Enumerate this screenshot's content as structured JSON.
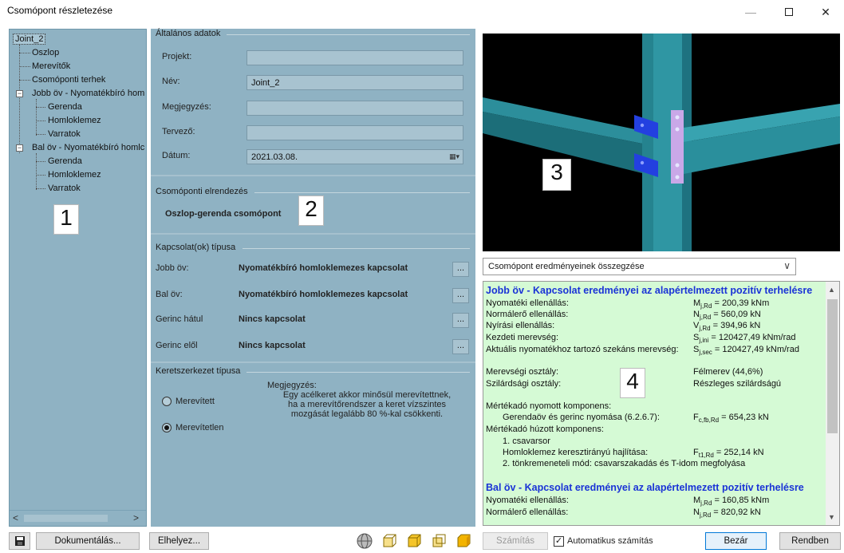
{
  "window": {
    "title": "Csomópont részletezése",
    "minimize": "—",
    "close": "✕"
  },
  "tree": {
    "root": "Joint_2",
    "items": [
      "Oszlop",
      "Merevítők",
      "Csomóponti terhek"
    ],
    "right_chord": {
      "label": "Jobb öv - Nyomatékbíró hom",
      "children": [
        "Gerenda",
        "Homloklemez",
        "Varratok"
      ]
    },
    "left_chord": {
      "label": "Bal öv - Nyomatékbíró homlc",
      "children": [
        "Gerenda",
        "Homloklemez",
        "Varratok"
      ]
    },
    "expander_symbol": "⊟",
    "scroll_left": "<",
    "scroll_right": ">"
  },
  "general": {
    "title": "Általános adatok",
    "project_label": "Projekt:",
    "project_value": "",
    "name_label": "Név:",
    "name_value": "Joint_2",
    "comment_label": "Megjegyzés:",
    "comment_value": "",
    "designer_label": "Tervező:",
    "designer_value": "",
    "date_label": "Dátum:",
    "date_value": "2021.03.08.",
    "date_icon": "▦▾"
  },
  "layout": {
    "title": "Csomóponti elrendezés",
    "value": "Oszlop-gerenda csomópont"
  },
  "connections": {
    "title": "Kapcsolat(ok) típusa",
    "dots": "...",
    "rows": [
      {
        "label": "Jobb öv:",
        "value": "Nyomatékbíró homloklemezes kapcsolat"
      },
      {
        "label": "Bal öv:",
        "value": "Nyomatékbíró homloklemezes kapcsolat"
      },
      {
        "label": "Gerinc hátul",
        "value": "Nincs kapcsolat"
      },
      {
        "label": "Gerinc elől",
        "value": "Nincs kapcsolat"
      }
    ]
  },
  "frame": {
    "title": "Keretszerkezet típusa",
    "note_label": "Megjegyzés:",
    "note_lines": [
      "Egy acélkeret akkor minősül merevítettnek,",
      "ha a merevítőrendszer a keret vízszintes",
      "mozgását legalább 80 %-kal csökkenti."
    ],
    "option_braced": "Merevített",
    "option_unbraced": "Merevítetlen",
    "selected": "Merevítetlen"
  },
  "markers": [
    "1",
    "2",
    "3",
    "4"
  ],
  "results_dropdown": {
    "value": "Csomópont eredményeinek összegzése",
    "chevron": "∨"
  },
  "results": {
    "right_head": "Jobb öv - Kapcsolat eredményei az alapértelmezett pozitív terhelésre",
    "rows": [
      {
        "label": "Nyomatéki ellenállás:",
        "sym": "M",
        "sub": "j,Rd",
        "val": " = 200,39 kNm"
      },
      {
        "label": "Normálerő ellenállás:",
        "sym": "N",
        "sub": "j,Rd",
        "val": " = 560,09 kN"
      },
      {
        "label": "Nyírási ellenállás:",
        "sym": "V",
        "sub": "j,Rd",
        "val": " = 394,96 kN"
      },
      {
        "label": "Kezdeti merevség:",
        "sym": "S",
        "sub": "j,ini",
        "val": " = 120427,49 kNm/rad"
      },
      {
        "label": "Aktuális nyomatékhoz tartozó szekáns merevség:",
        "sym": "S",
        "sub": "j,sec",
        "val": " = 120427,49 kNm/rad"
      }
    ],
    "stiffness_class_label": "Merevségi osztály:",
    "stiffness_class_value": "Félmerev (44,6%)",
    "strength_class_label": "Szilárdsági osztály:",
    "strength_class_value": "Részleges szilárdságú",
    "compressed_label": "Mértékadó nyomott komponens:",
    "compressed_item": "Gerendaöv és gerinc nyomása (6.2.6.7):",
    "compressed_sym": "F",
    "compressed_sub": "c,fb,Rd",
    "compressed_val": " = 654,23 kN",
    "tension_label": "Mértékadó húzott komponens:",
    "bolt_row": "1. csavarsor",
    "plate_bending": "Homloklemez keresztirányú hajlítása:",
    "plate_sym": "F",
    "plate_sub": "t1,Rd",
    "plate_val": " = 252,14 kN",
    "failure_mode": "2. tönkremeneteli mód: csavarszakadás és T-idom megfolyása",
    "left_head": "Bal öv - Kapcsolat eredményei az alapértelmezett pozitív terhelésre",
    "left_rows": [
      {
        "label": "Nyomatéki ellenállás:",
        "sym": "M",
        "sub": "j,Rd",
        "val": " = 160,85 kNm"
      },
      {
        "label": "Normálerő ellenállás:",
        "sym": "N",
        "sub": "j,Rd",
        "val": " = 820,92 kN"
      }
    ],
    "scroll_up": "▲",
    "scroll_down": "▼"
  },
  "bottom": {
    "document_btn": "Dokumentálás...",
    "place_btn": "Elhelyez...",
    "calc_btn": "Számítás",
    "auto_calc_label": "Automatikus számítás",
    "auto_calc_checked": "✓",
    "close_btn": "Bezár",
    "ok_btn": "Rendben"
  },
  "colors": {
    "panel": "#8fb2c3",
    "results_bg": "#d5fad5",
    "results_head": "#1a33d6",
    "steel": "#2a8f9c"
  }
}
